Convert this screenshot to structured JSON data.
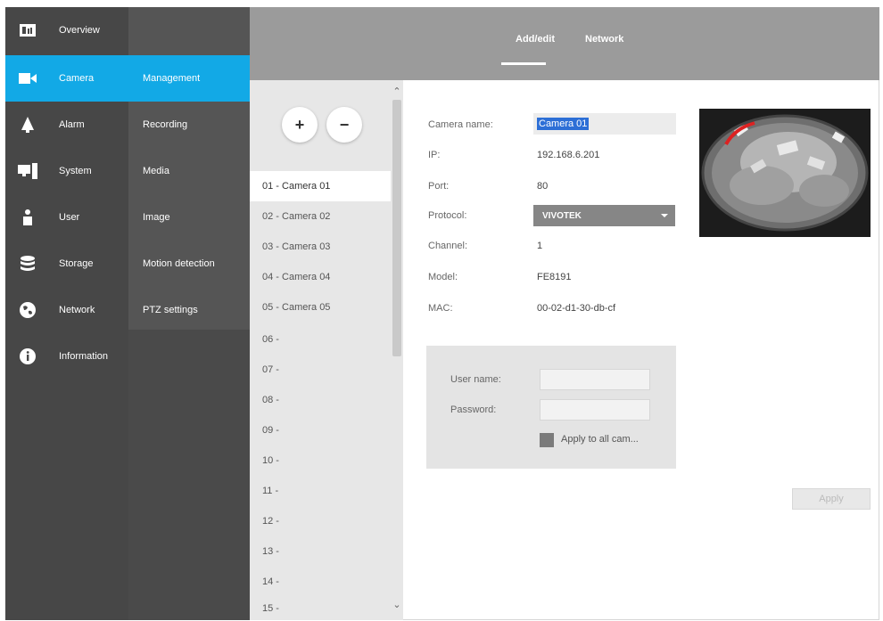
{
  "nav": {
    "items": [
      {
        "label": "Overview",
        "icon": "overview-icon",
        "active": false
      },
      {
        "label": "Camera",
        "icon": "camera-icon",
        "active": true
      },
      {
        "label": "Alarm",
        "icon": "bell-icon",
        "active": false
      },
      {
        "label": "System",
        "icon": "computer-icon",
        "active": false
      },
      {
        "label": "User",
        "icon": "user-icon",
        "active": false
      },
      {
        "label": "Storage",
        "icon": "database-icon",
        "active": false
      },
      {
        "label": "Network",
        "icon": "globe-icon",
        "active": false
      },
      {
        "label": "Information",
        "icon": "info-icon",
        "active": false
      }
    ]
  },
  "subnav": {
    "items": [
      {
        "label": "Management",
        "active": true
      },
      {
        "label": "Recording",
        "active": false
      },
      {
        "label": "Media",
        "active": false
      },
      {
        "label": "Image",
        "active": false
      },
      {
        "label": "Motion detection",
        "active": false
      },
      {
        "label": "PTZ settings",
        "active": false
      }
    ]
  },
  "tabs": [
    {
      "label": "Add/edit",
      "active": true
    },
    {
      "label": "Network",
      "active": false
    }
  ],
  "camera_list": {
    "add_label": "+",
    "remove_label": "−",
    "items": [
      "01 - Camera 01",
      "02 - Camera 02",
      "03 - Camera 03",
      "04 - Camera 04",
      "05 - Camera 05",
      "06 -",
      "07 -",
      "08 -",
      "09 -",
      "10 -",
      "11 -",
      "12 -",
      "13 -",
      "14 -",
      "15 -"
    ],
    "selected_index": 0
  },
  "form": {
    "camera_name_label": "Camera name:",
    "camera_name_value": "Camera 01",
    "ip_label": "IP:",
    "ip_value": "192.168.6.201",
    "port_label": "Port:",
    "port_value": "80",
    "protocol_label": "Protocol:",
    "protocol_value": "VIVOTEK",
    "channel_label": "Channel:",
    "channel_value": "1",
    "model_label": "Model:",
    "model_value": "FE8191",
    "mac_label": "MAC:",
    "mac_value": "00-02-d1-30-db-cf",
    "username_label": "User name:",
    "password_label": "Password:",
    "apply_all_label": "Apply to all cam..."
  },
  "apply_button_label": "Apply",
  "colors": {
    "accent": "#12a9e6",
    "nav_bg": "#474747",
    "subnav_bg": "#555555",
    "topbar_bg": "#9b9b9b"
  }
}
